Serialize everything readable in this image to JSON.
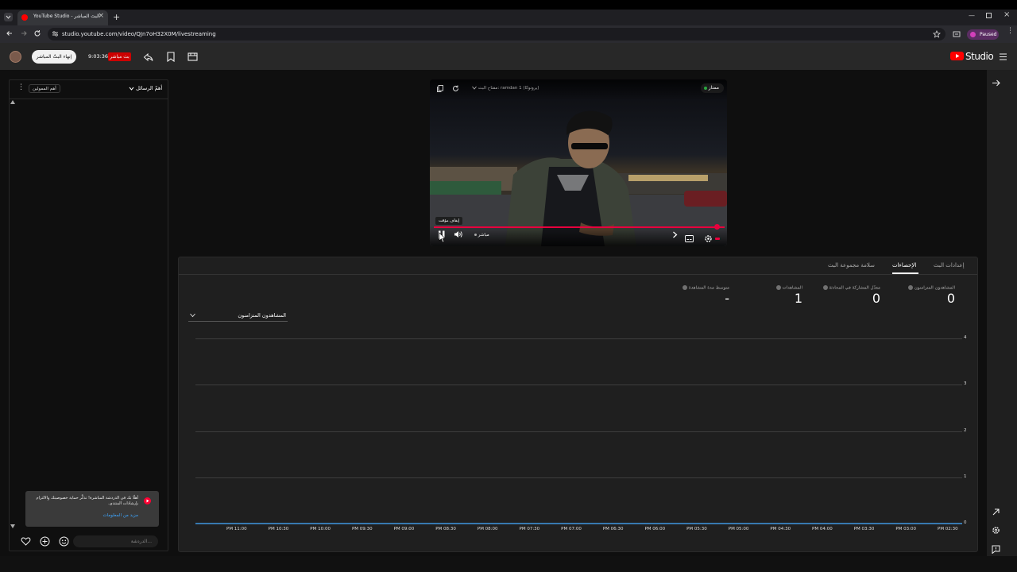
{
  "browser": {
    "tab_title": "YouTube Studio - البث المباشر",
    "url": "studio.youtube.com/video/QJn7oH32X0M/livestreaming",
    "profile_status": "Paused",
    "profile_initial": "a"
  },
  "header": {
    "end_stream_label": "إنهاء البثّ المباشر",
    "timer": "9:03:36",
    "live_badge": "بث مباشر",
    "studio_label": "Studio"
  },
  "chat": {
    "mode_label": "أهمّ الرسائل",
    "sponsors_label": "أهم الممولين",
    "notice_text": "أهلًا بك في الدردشة المباشرة! تذكَّر حماية خصوصيتك والالتزام بإرشادات المنتدى.",
    "notice_link": "مزيد من المعلومات",
    "input_placeholder": "الدردشة..."
  },
  "player": {
    "status_label": "ممتاز",
    "stream_key_label": "مفتاح البث: ramdan 1 (يرونوكا)",
    "tooltip": "إيقاف مؤقت",
    "live_label": "مباشر"
  },
  "stats": {
    "tabs": [
      "إعدادات البث",
      "الإحصاءات",
      "سلامة مجموعة البث"
    ],
    "active_tab": "الإحصاءات",
    "metrics": [
      {
        "label": "المشاهدون المتزامنون",
        "value": "0"
      },
      {
        "label": "معدّل المشاركة في المحادثة",
        "value": "0"
      },
      {
        "label": "المشاهدات",
        "value": "1"
      },
      {
        "label": "متوسط مدة المشاهدة",
        "value": "-"
      }
    ],
    "chart_selector": "المشاهدون المتزامنون"
  },
  "colors": {
    "accent_red": "#ff0000",
    "progress_red": "#e8003d",
    "line_blue": "#3ea6ff",
    "status_green": "#2ba640"
  },
  "chart_data": {
    "type": "line",
    "title": "",
    "xlabel": "",
    "ylabel": "",
    "categories": [
      "PM 11:00",
      "PM 10:30",
      "PM 10:00",
      "PM 09:30",
      "PM 09:00",
      "PM 08:30",
      "PM 08:00",
      "PM 07:30",
      "PM 07:00",
      "PM 06:30",
      "PM 06:00",
      "PM 05:30",
      "PM 05:00",
      "PM 04:30",
      "PM 04:00",
      "PM 03:30",
      "PM 03:00",
      "PM 02:30"
    ],
    "values": [
      0,
      0,
      0,
      0,
      0,
      0,
      0,
      0,
      0,
      0,
      0,
      0,
      0,
      0,
      0,
      0,
      0,
      0
    ],
    "yticks": [
      "0",
      "1",
      "2",
      "3",
      "4"
    ],
    "ylim": [
      0,
      4
    ],
    "grid": true
  }
}
